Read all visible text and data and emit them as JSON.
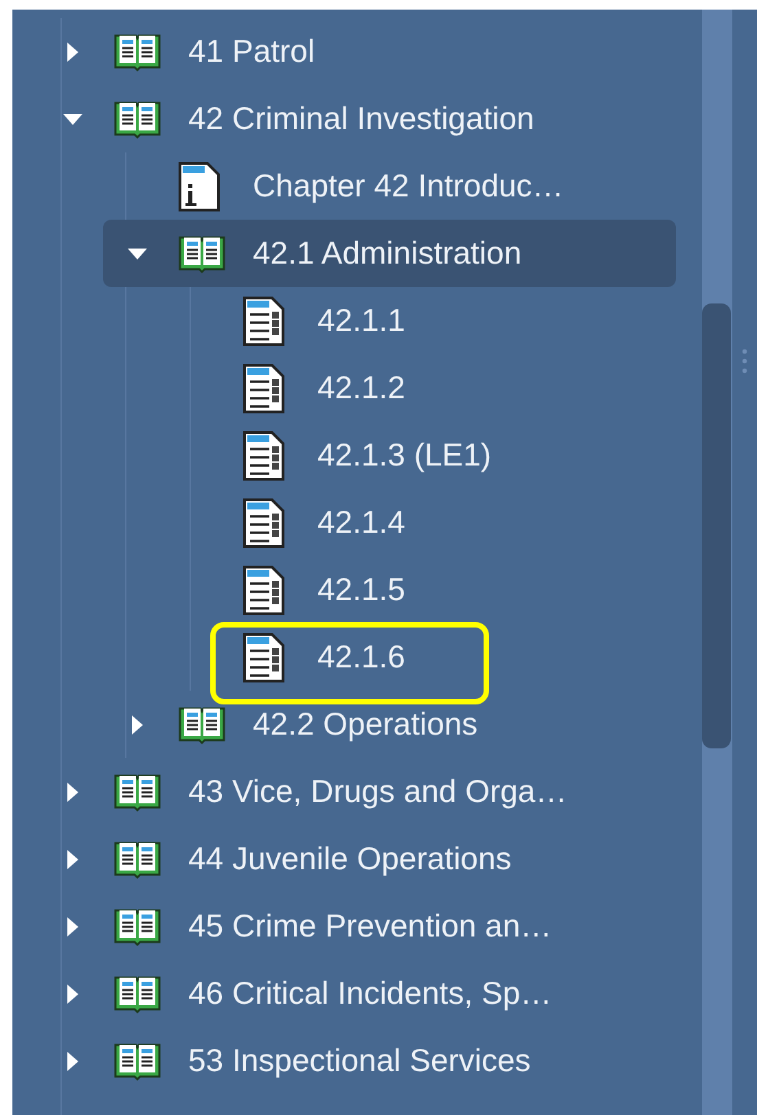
{
  "tree": [
    {
      "label": "41 Patrol",
      "kind": "book",
      "expanded": false,
      "selected": false,
      "annotated": false
    },
    {
      "label": "42 Criminal Investigation",
      "kind": "book",
      "expanded": true,
      "selected": false,
      "annotated": false,
      "children": [
        {
          "label": "Chapter 42 Introduc…",
          "kind": "info",
          "selected": false,
          "annotated": false
        },
        {
          "label": "42.1 Administration",
          "kind": "book",
          "expanded": true,
          "selected": true,
          "annotated": false,
          "children": [
            {
              "label": "42.1.1",
              "kind": "page",
              "selected": false,
              "annotated": false
            },
            {
              "label": "42.1.2",
              "kind": "page",
              "selected": false,
              "annotated": false
            },
            {
              "label": "42.1.3 (LE1)",
              "kind": "page",
              "selected": false,
              "annotated": false
            },
            {
              "label": "42.1.4",
              "kind": "page",
              "selected": false,
              "annotated": false
            },
            {
              "label": "42.1.5",
              "kind": "page",
              "selected": false,
              "annotated": false
            },
            {
              "label": "42.1.6",
              "kind": "page",
              "selected": false,
              "annotated": true
            }
          ]
        },
        {
          "label": "42.2 Operations",
          "kind": "book",
          "expanded": false,
          "selected": false,
          "annotated": false
        }
      ]
    },
    {
      "label": "43 Vice, Drugs and Orga…",
      "kind": "book",
      "expanded": false,
      "selected": false,
      "annotated": false
    },
    {
      "label": "44 Juvenile Operations",
      "kind": "book",
      "expanded": false,
      "selected": false,
      "annotated": false
    },
    {
      "label": "45 Crime Prevention an…",
      "kind": "book",
      "expanded": false,
      "selected": false,
      "annotated": false
    },
    {
      "label": "46 Critical Incidents, Sp…",
      "kind": "book",
      "expanded": false,
      "selected": false,
      "annotated": false
    },
    {
      "label": "53 Inspectional Services",
      "kind": "book",
      "expanded": false,
      "selected": false,
      "annotated": false
    }
  ]
}
